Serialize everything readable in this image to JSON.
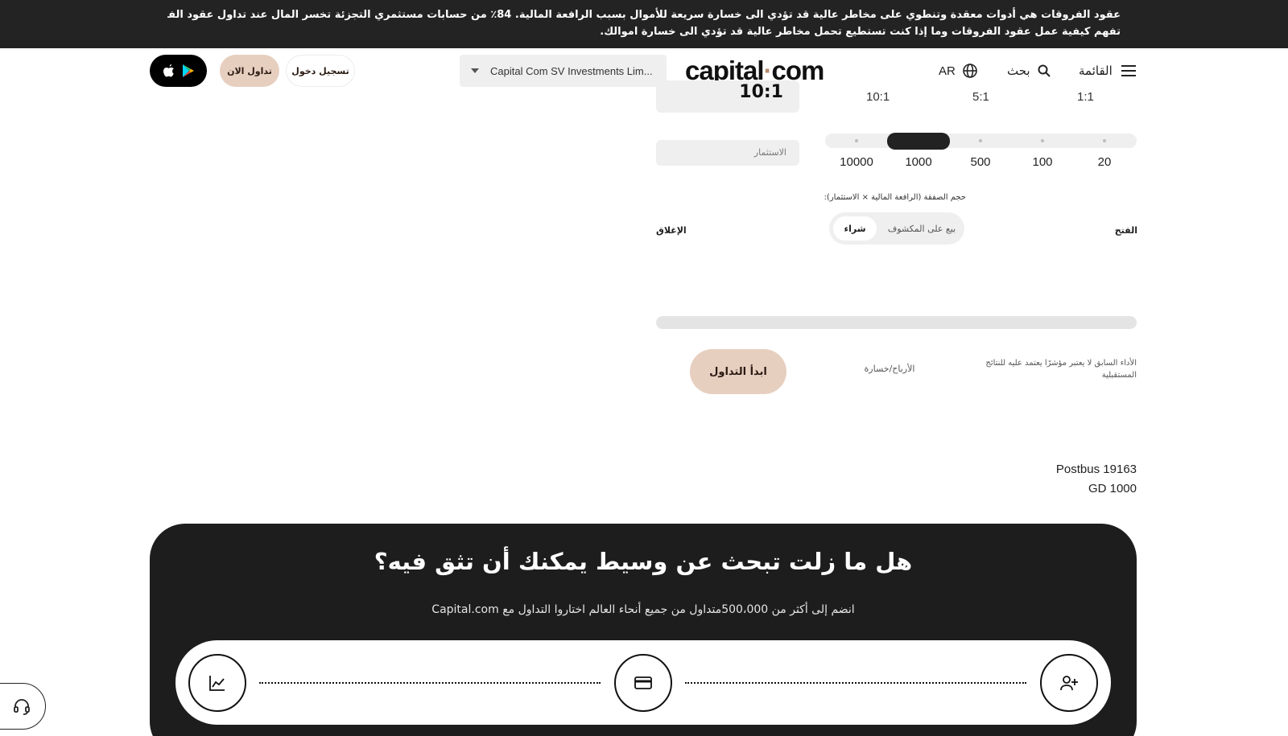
{
  "risk_warning": {
    "line1": "عقود الفروقات هي أدوات معقدة وتنطوي على مخاطر عالية قد تؤدي الى خسارة سريعة للأموال بسبب الرافعة المالية. 84٪ من حسابات مستثمري التجزئة تخسر المال عند تداول عقود الفروقات مع هذا المزود. يجب أن تفكر فيما إذا كنت",
    "line2": "تفهم كيفية عمل عقود الفروقات وما إذا كنت تستطيع تحمل مخاطر عالية قد تؤدي الى خسارة اموالك."
  },
  "header": {
    "menu_label": "القائمة",
    "search_label": "بحث",
    "language": "AR",
    "logo_text": "capital",
    "logo_suffix": "com",
    "entity_select": "Capital Com SV Investments Lim...",
    "login_label": "تسجيل دخول",
    "trade_now_label": "تداول الان"
  },
  "calculator": {
    "leverage_value": "10:1",
    "leverage_options": [
      "10:1",
      "5:1",
      "1:1"
    ],
    "investment_placeholder": "الاستثمار",
    "investment_options": [
      "10000",
      "1000",
      "500",
      "100",
      "20"
    ],
    "investment_selected": "1000",
    "trade_size_label": "حجم الصفقة (الرافعة المالية × الاستثمار):",
    "open_label": "الفتح",
    "close_label": "الإغلاق",
    "direction_buy": "شراء",
    "direction_sell": "بيع على المكشوف",
    "direction_selected": "شراء",
    "pnl_label": "الأرباح/خسارة",
    "start_button": "ابدأ التداول",
    "past_performance": "الأداء السابق لا يعتبر مؤشرًا يعتمد عليه للنتائج المستقبلية"
  },
  "address": {
    "line1": "Postbus 19163",
    "line2": "GD 1000"
  },
  "trust": {
    "title": "هل ما زلت تبحث عن وسيط يمكنك أن تثق فيه؟",
    "subtitle": "انضم إلى أكثر من 500،000متداول من جميع أنحاء العالم اختاروا التداول مع Capital.com",
    "step_icons": [
      "chart-line-icon",
      "credit-card-icon",
      "user-plus-icon"
    ]
  },
  "colors": {
    "banner_bg": "#232323",
    "accent_beige": "#e7cfc0",
    "trust_bg": "#1d1d1d",
    "logo_dot": "#b58b6f"
  }
}
